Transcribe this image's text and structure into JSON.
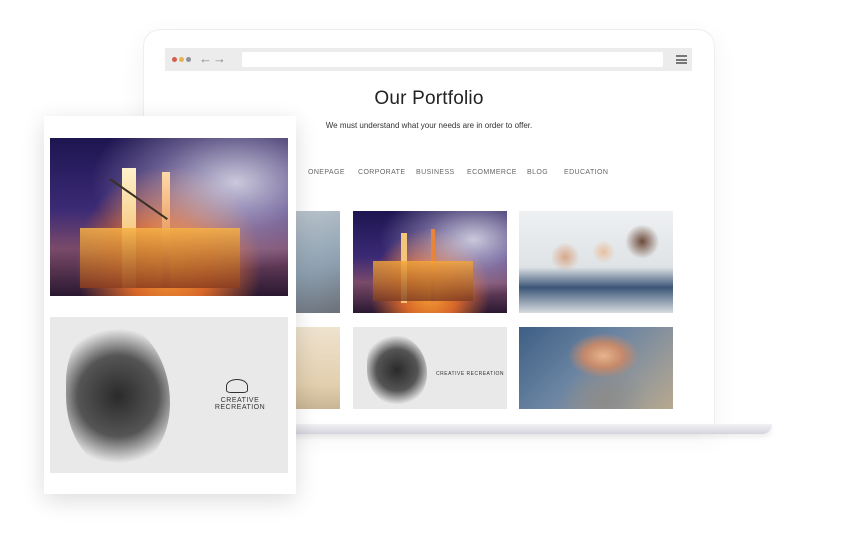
{
  "page": {
    "title": "Our Portfolio",
    "subtitle": "We must understand what your needs are in order to offer."
  },
  "filters": [
    "ONEPAGE",
    "CORPORATE",
    "BUSINESS",
    "ECOMMERCE",
    "BLOG",
    "EDUCATION"
  ],
  "brand": {
    "name": "CREATIVE RECREATION"
  },
  "colors": {
    "dot_red": "#d55d4f",
    "dot_yellow": "#e3b54b",
    "dot_gray": "#8f9298",
    "browser_bar": "#ececec"
  },
  "icons": [
    "back-arrow-icon",
    "forward-arrow-icon",
    "hamburger-menu-icon"
  ]
}
